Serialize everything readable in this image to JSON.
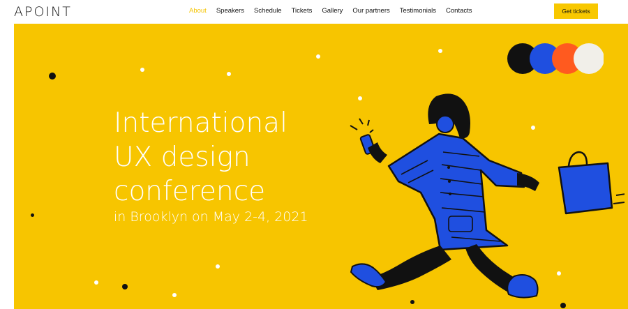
{
  "header": {
    "logo": "APOINT",
    "nav": [
      {
        "label": "About",
        "active": true
      },
      {
        "label": "Speakers",
        "active": false
      },
      {
        "label": "Schedule",
        "active": false
      },
      {
        "label": "Tickets",
        "active": false
      },
      {
        "label": "Gallery",
        "active": false
      },
      {
        "label": "Our partners",
        "active": false
      },
      {
        "label": "Testimonials",
        "active": false
      },
      {
        "label": "Contacts",
        "active": false
      }
    ],
    "cta_label": "Get tickets"
  },
  "hero": {
    "title_lines": [
      "International",
      "UX design",
      "conference"
    ],
    "subtitle": "in Brooklyn on May 2-4, 2021"
  },
  "colors": {
    "accent": "#f7c500",
    "blue": "#1f4fe0",
    "orange": "#ff5a1f",
    "black": "#111111",
    "cream": "#f1efe9"
  },
  "icons": [
    "color-palette-circles-icon",
    "walking-woman-illustration"
  ]
}
